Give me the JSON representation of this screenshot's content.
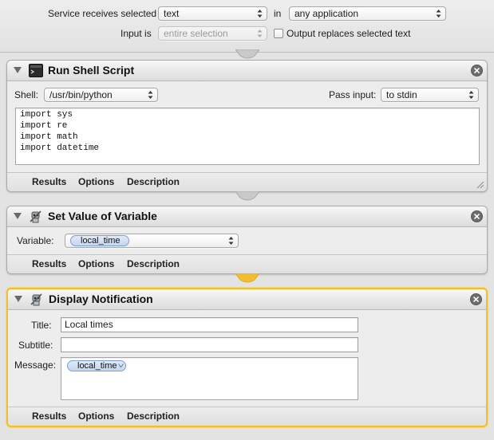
{
  "workflow_header": {
    "service_receives_label": "Service receives selected",
    "service_receives_value": "text",
    "in_label": "in",
    "application_value": "any application",
    "input_is_label": "Input is",
    "input_is_value": "entire selection",
    "output_replaces_label": "Output replaces selected text",
    "output_replaces_checked": false
  },
  "actions": [
    {
      "title": "Run Shell Script",
      "icon": "terminal-icon",
      "shell_label": "Shell:",
      "shell_value": "/usr/bin/python",
      "pass_input_label": "Pass input:",
      "pass_input_value": "to stdin",
      "script": "import sys\nimport re\nimport math\nimport datetime",
      "tabs": [
        "Results",
        "Options",
        "Description"
      ]
    },
    {
      "title": "Set Value of Variable",
      "icon": "automator-robot-icon",
      "variable_label": "Variable:",
      "variable_value": "local_time",
      "tabs": [
        "Results",
        "Options",
        "Description"
      ]
    },
    {
      "title": "Display Notification",
      "icon": "automator-robot-icon",
      "title_label": "Title:",
      "title_value": "Local times",
      "subtitle_label": "Subtitle:",
      "subtitle_value": "",
      "message_label": "Message:",
      "message_token": "local_time",
      "tabs": [
        "Results",
        "Options",
        "Description"
      ],
      "selected": true
    }
  ],
  "colors": {
    "selection_border": "#f2be2f",
    "token_fill": "#c6d7f0",
    "background": "#e3e3e3"
  }
}
